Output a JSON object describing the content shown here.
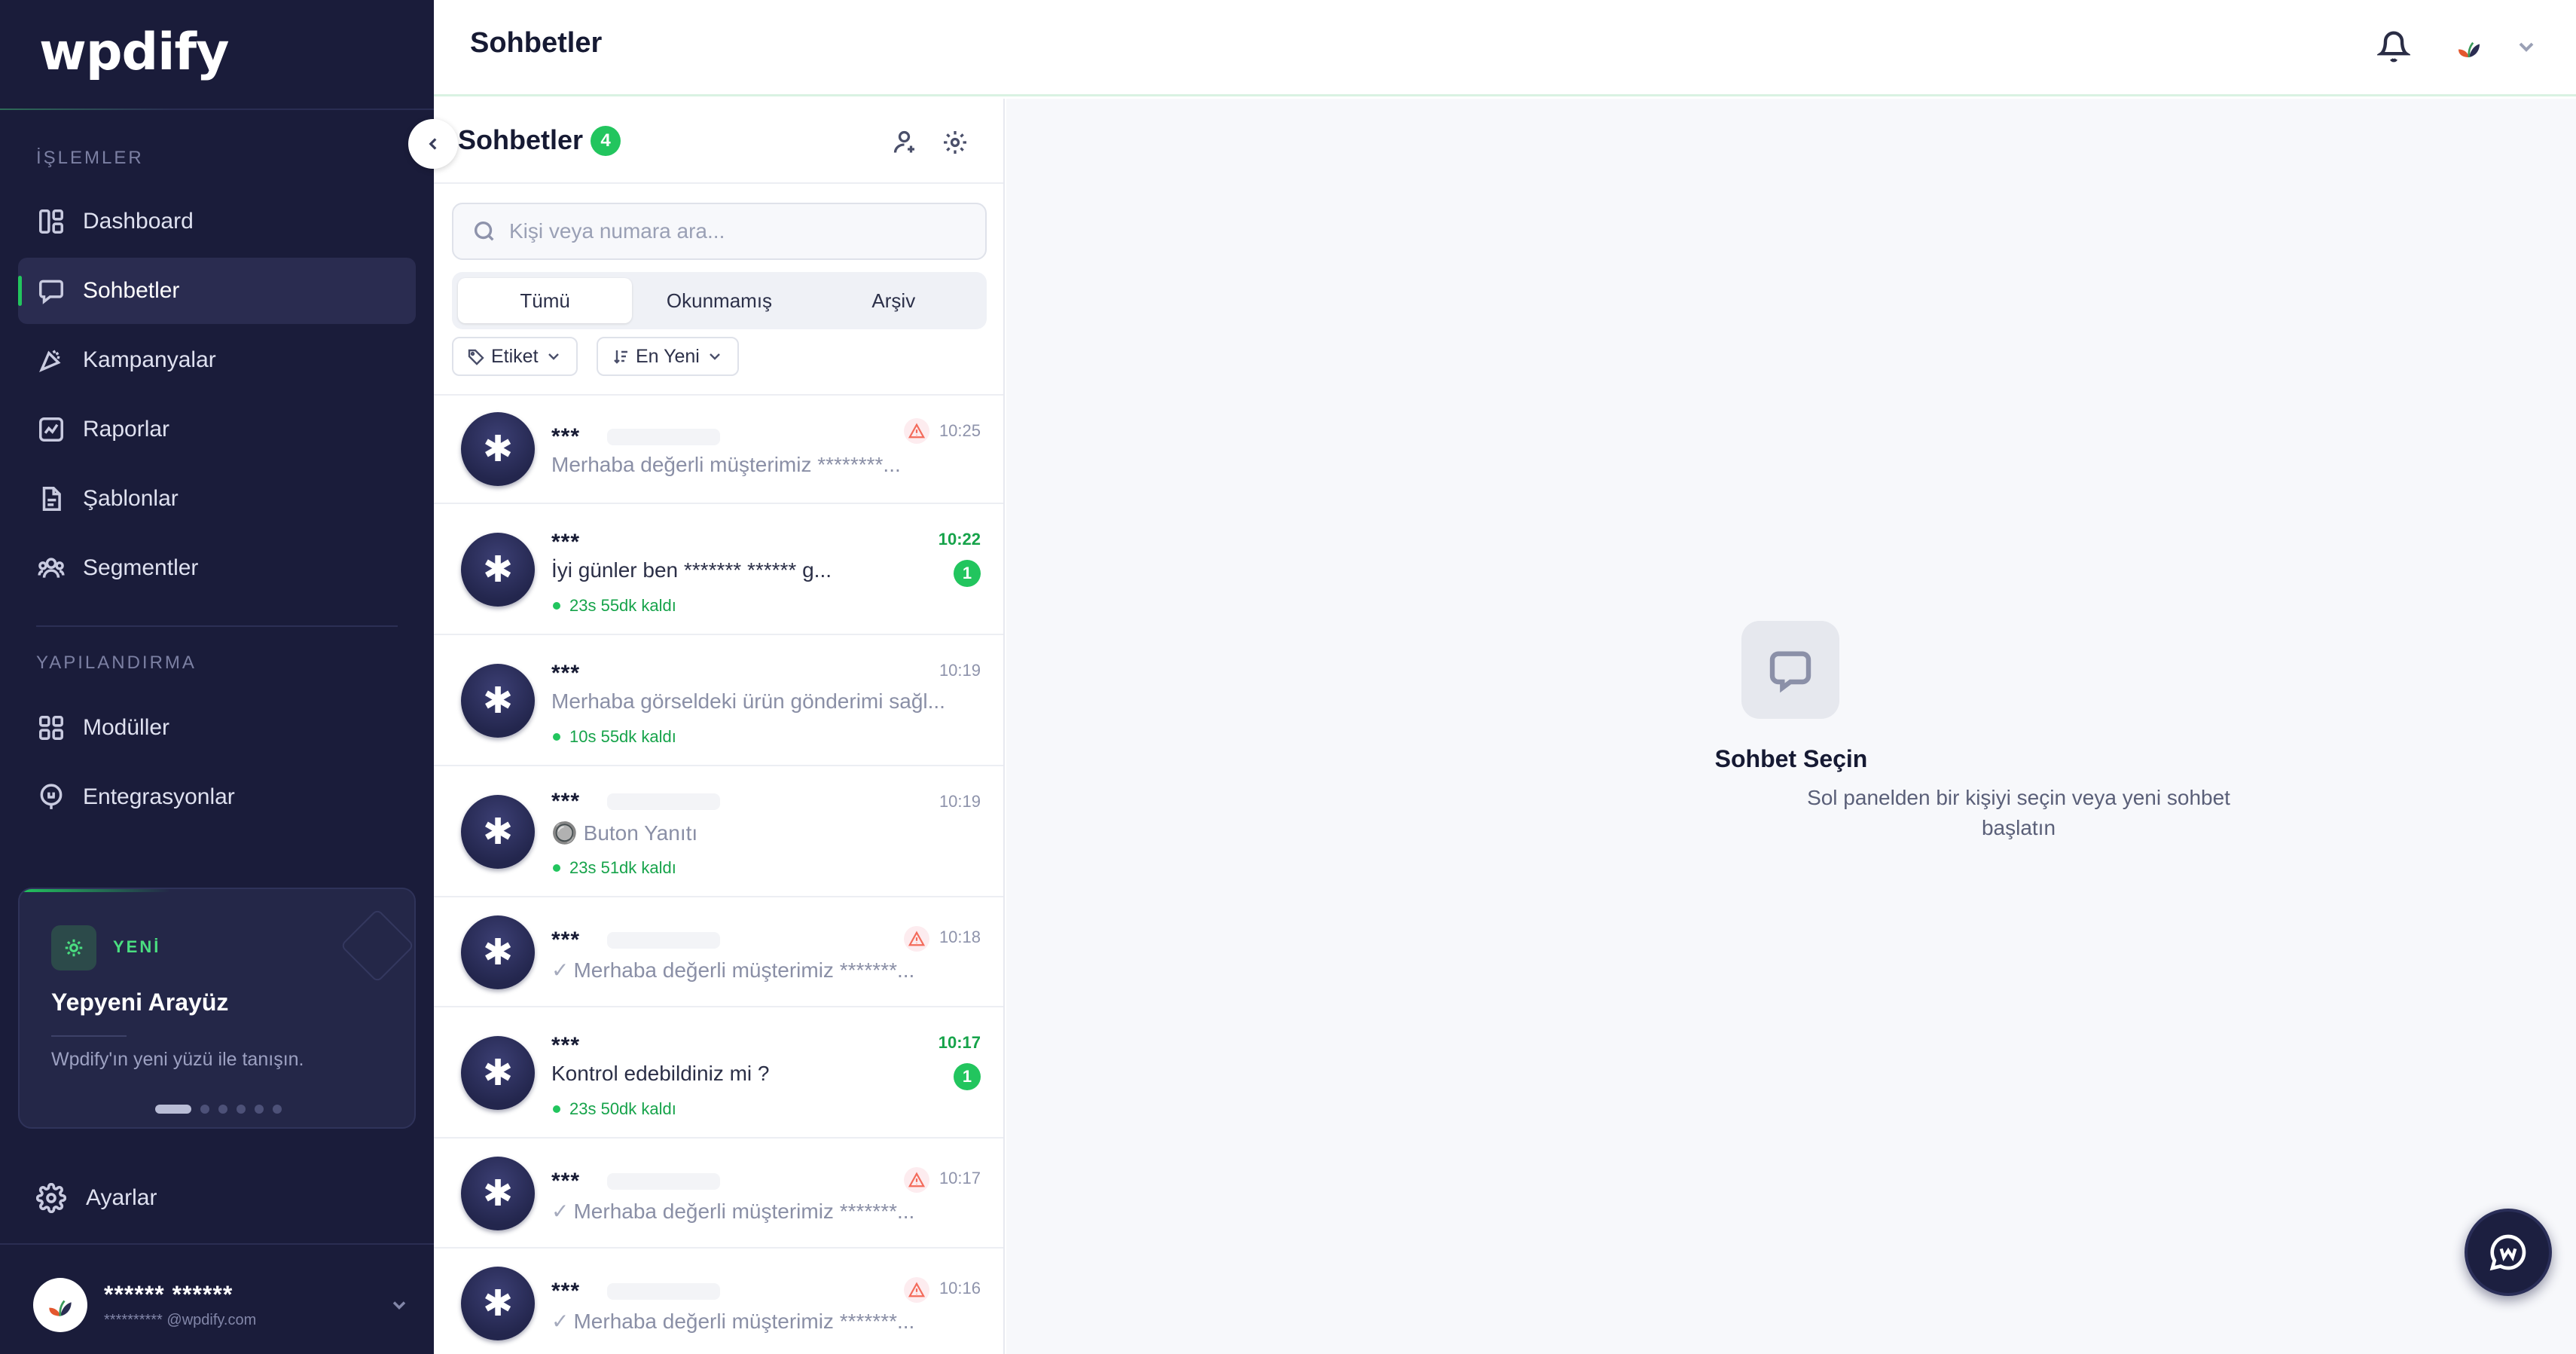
{
  "sidebar": {
    "logo": "wpdify",
    "section_operations": "İŞLEMLER",
    "section_config": "YAPILANDIRMA",
    "items": [
      {
        "label": "Dashboard",
        "icon": "dashboard-icon"
      },
      {
        "label": "Sohbetler",
        "icon": "chat-icon",
        "active": true
      },
      {
        "label": "Kampanyalar",
        "icon": "megaphone-icon"
      },
      {
        "label": "Raporlar",
        "icon": "report-icon"
      },
      {
        "label": "Şablonlar",
        "icon": "template-icon"
      },
      {
        "label": "Segmentler",
        "icon": "segment-icon"
      }
    ],
    "config_items": [
      {
        "label": "Modüller",
        "icon": "modules-icon"
      },
      {
        "label": "Entegrasyonlar",
        "icon": "integration-icon"
      }
    ],
    "promo": {
      "tag": "YENİ",
      "title": "Yepyeni Arayüz",
      "description": "Wpdify'ın yeni yüzü ile tanışın."
    },
    "settings_label": "Ayarlar",
    "user": {
      "name": "****** ******",
      "email": "********** @wpdify.com"
    }
  },
  "topbar": {
    "title": "Sohbetler"
  },
  "chat_list": {
    "title": "Sohbetler",
    "count": "4",
    "search_placeholder": "Kişi veya numara ara...",
    "tabs": [
      "Tümü",
      "Okunmamış",
      "Arşiv"
    ],
    "filter_tag": "Etiket",
    "filter_sort": "En Yeni",
    "chats": [
      {
        "name": "***",
        "time": "10:25",
        "message": "Merhaba değerli müşterimiz ********...",
        "warn": true
      },
      {
        "name": "***",
        "time": "10:22",
        "message": "İyi günler ben ******* ****** g...",
        "unread": "1",
        "timer": "23s 55dk kaldı"
      },
      {
        "name": "***",
        "time": "10:19",
        "message": "Merhaba görseldeki ürün gönderimi sağl...",
        "timer": "10s 55dk kaldı"
      },
      {
        "name": "***",
        "time": "10:19",
        "message": "🔘 Buton Yanıtı",
        "timer": "23s 51dk kaldı"
      },
      {
        "name": "***",
        "time": "10:18",
        "message": "Merhaba değerli müşterimiz *******...",
        "warn": true,
        "tick": "✓"
      },
      {
        "name": "***",
        "time": "10:17",
        "message": "Kontrol edebildiniz mi ?",
        "unread": "1",
        "timer": "23s 50dk kaldı"
      },
      {
        "name": "***",
        "time": "10:17",
        "message": "Merhaba değerli müşterimiz *******...",
        "warn": true,
        "tick": "✓"
      },
      {
        "name": "***",
        "time": "10:16",
        "message": "Merhaba değerli müşterimiz *******...",
        "warn": true,
        "tick": "✓"
      }
    ]
  },
  "empty_state": {
    "title": "Sohbet Seçin",
    "description": "Sol panelden bir kişiyi seçin veya yeni sohbet başlatın"
  },
  "colors": {
    "sidebar_bg": "#1a1c3a",
    "accent_green": "#22c55e",
    "warning": "#f36b5b"
  }
}
